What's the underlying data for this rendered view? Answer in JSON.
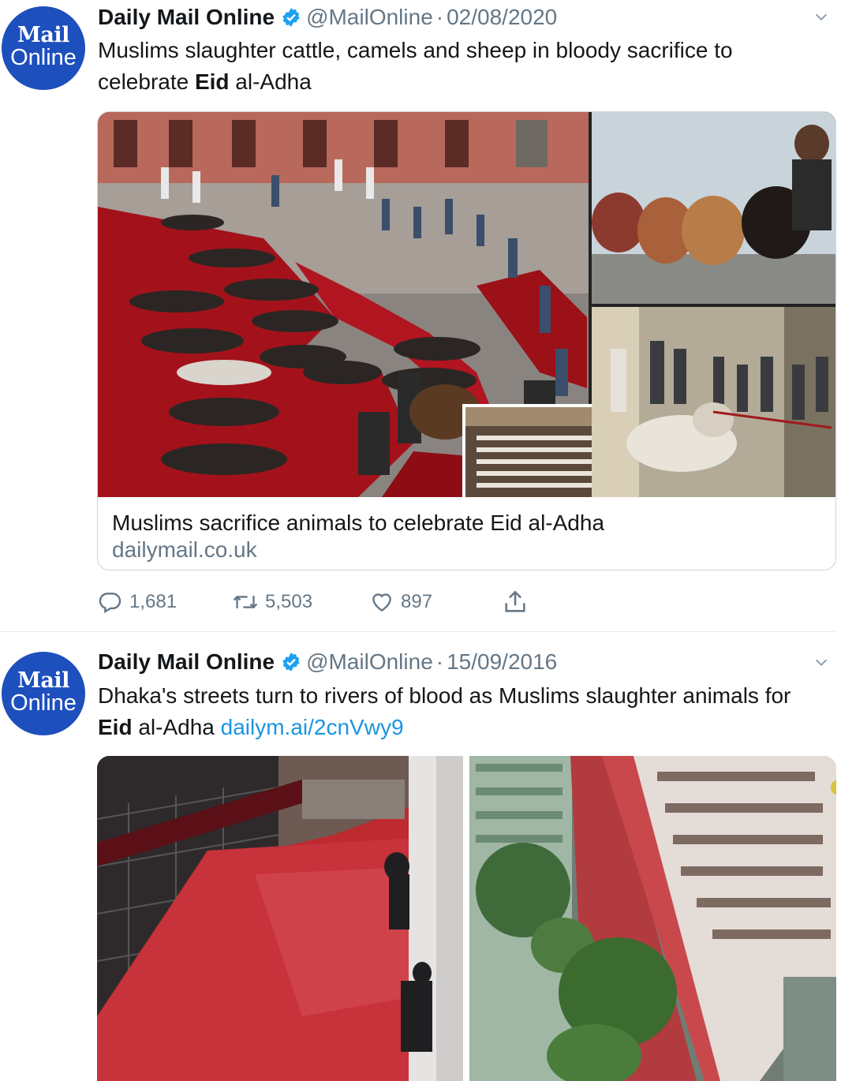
{
  "tweets": [
    {
      "avatar": {
        "line1": "Mail",
        "line2": "Online"
      },
      "name": "Daily Mail Online",
      "handle": "@MailOnline",
      "separator": "·",
      "date": "02/08/2020",
      "text_pre": "Muslims slaughter cattle, camels and sheep in bloody sacrifice to celebrate ",
      "text_bold": "Eid",
      "text_post": " al-Adha",
      "card": {
        "title": "Muslims sacrifice animals to celebrate Eid al-Adha",
        "domain": "dailymail.co.uk"
      },
      "actions": {
        "replies": "1,681",
        "retweets": "5,503",
        "likes": "897"
      }
    },
    {
      "avatar": {
        "line1": "Mail",
        "line2": "Online"
      },
      "name": "Daily Mail Online",
      "handle": "@MailOnline",
      "separator": "·",
      "date": "15/09/2016",
      "text_pre": "Dhaka's streets turn to rivers of blood as Muslims slaughter animals for ",
      "text_bold": "Eid",
      "text_post": " al-Adha ",
      "link": "dailym.ai/2cnVwy9"
    }
  ],
  "colors": {
    "accent": "#1b95e0",
    "verified": "#1da1f2",
    "avatar": "#1d4fbd",
    "muted": "#657786",
    "blood": "#b3121c"
  }
}
